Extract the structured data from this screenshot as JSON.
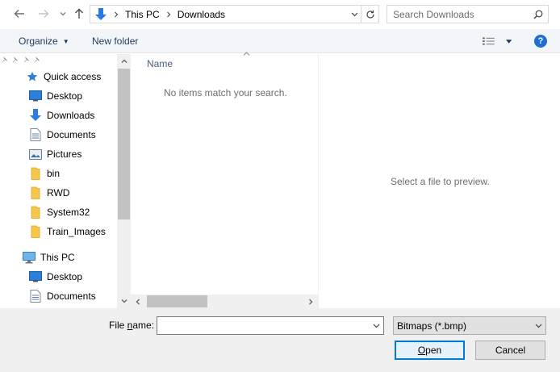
{
  "address": {
    "crumbs": [
      "This PC",
      "Downloads"
    ]
  },
  "search": {
    "placeholder": "Search Downloads",
    "value": ""
  },
  "toolbar": {
    "organize_label": "Organize",
    "new_folder_label": "New folder",
    "help_label": "?"
  },
  "nav": {
    "quick_access": "Quick access",
    "items": [
      {
        "label": "Desktop",
        "icon": "desktop-icon",
        "pinned": true
      },
      {
        "label": "Downloads",
        "icon": "downloads-icon",
        "pinned": true
      },
      {
        "label": "Documents",
        "icon": "documents-icon",
        "pinned": true
      },
      {
        "label": "Pictures",
        "icon": "pictures-icon",
        "pinned": true
      },
      {
        "label": "bin",
        "icon": "folder-icon",
        "pinned": false
      },
      {
        "label": "RWD",
        "icon": "folder-icon",
        "pinned": false
      },
      {
        "label": "System32",
        "icon": "folder-icon",
        "pinned": false
      },
      {
        "label": "Train_Images",
        "icon": "folder-icon",
        "pinned": false
      }
    ],
    "this_pc": "This PC",
    "pc_items": [
      {
        "label": "Desktop",
        "icon": "desktop-icon"
      },
      {
        "label": "Documents",
        "icon": "documents-icon"
      }
    ]
  },
  "file_list": {
    "column_name": "Name",
    "empty_message": "No items match your search."
  },
  "preview": {
    "message": "Select a file to preview."
  },
  "bottom": {
    "file_name_prefix": "File ",
    "file_name_underlined": "n",
    "file_name_suffix": "ame:",
    "file_name_value": "",
    "file_type": "Bitmaps (*.bmp)",
    "open_underlined": "O",
    "open_rest": "pen",
    "cancel_label": "Cancel"
  },
  "colors": {
    "accent": "#0078d7",
    "toolbar_bg": "#f3f6f9",
    "toolbar_text": "#1e395b",
    "panel_bg": "#f0f0f0",
    "help": "#1f6fd1",
    "folder": "#f6c84a"
  }
}
